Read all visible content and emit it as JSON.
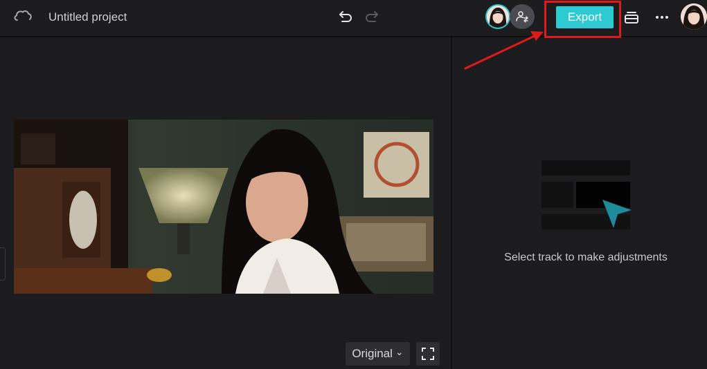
{
  "header": {
    "project_title": "Untitled project",
    "export_label": "Export",
    "icons": [
      "cloud-icon",
      "undo-icon",
      "redo-icon",
      "invite-collaborator-icon",
      "layers-icon",
      "more-icon"
    ]
  },
  "preview": {
    "ratio_label": "Original",
    "ratio_chevron": "⌄"
  },
  "properties_panel": {
    "hint": "Select track to make adjustments"
  },
  "colors": {
    "accent": "#2ccbd3",
    "annotation": "#e01a1a",
    "background": "#1c1c1e"
  }
}
